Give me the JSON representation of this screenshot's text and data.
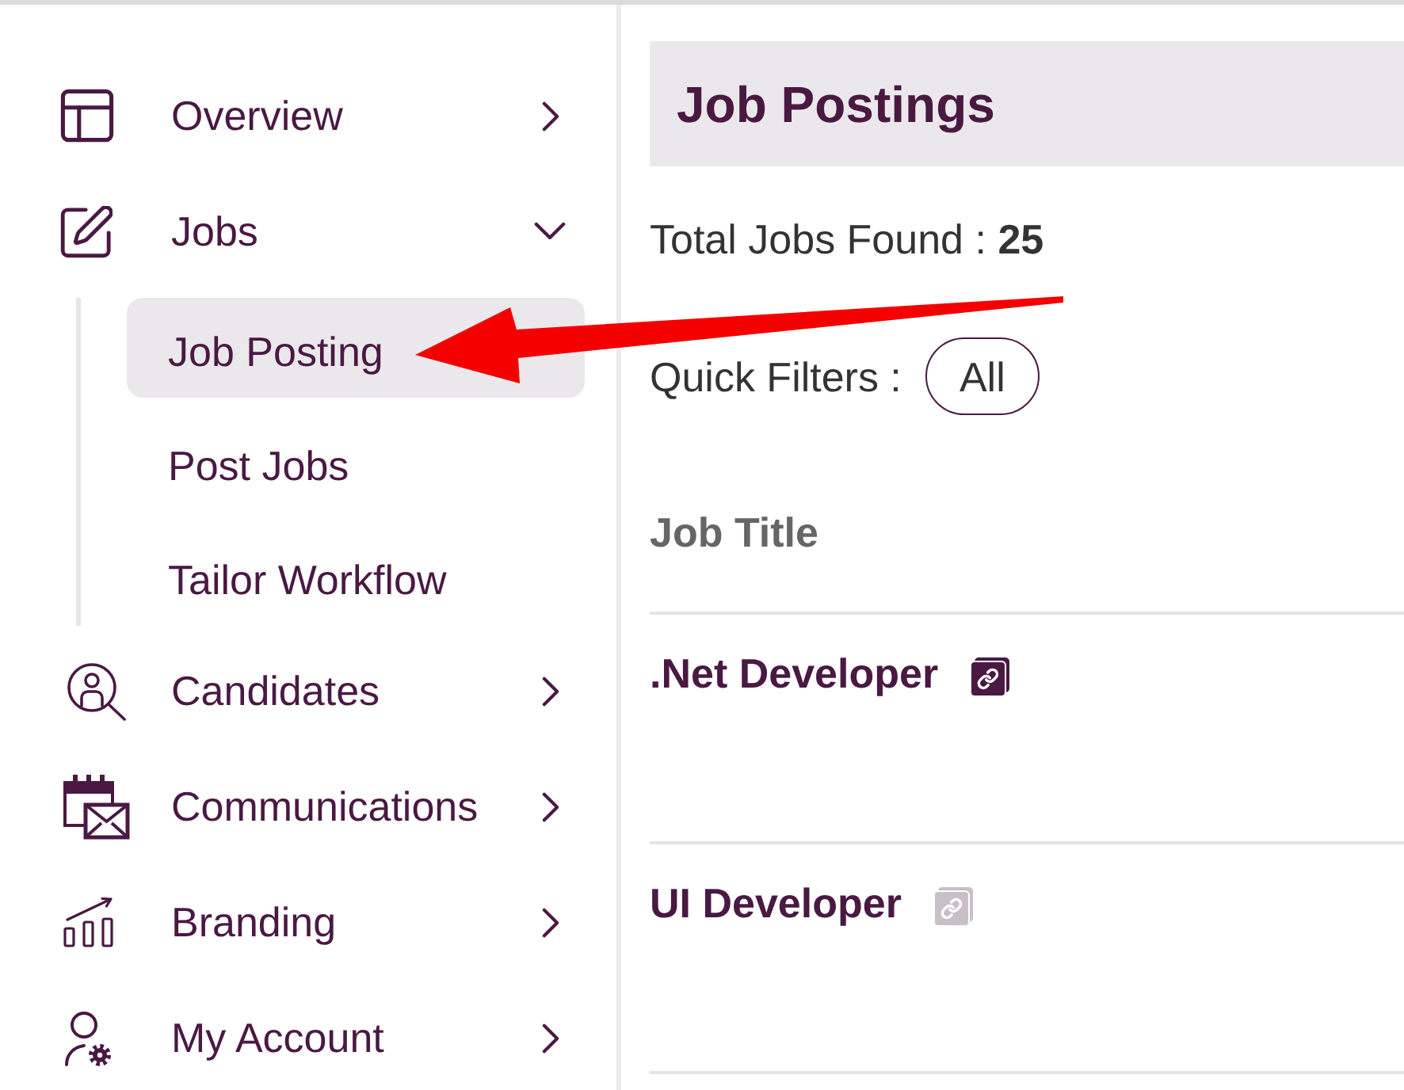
{
  "sidebar": {
    "items": [
      {
        "label": "Overview",
        "expanded": false
      },
      {
        "label": "Jobs",
        "expanded": true,
        "children": [
          {
            "label": "Job Posting",
            "selected": true
          },
          {
            "label": "Post Jobs",
            "selected": false
          },
          {
            "label": "Tailor Workflow",
            "selected": false
          }
        ]
      },
      {
        "label": "Candidates",
        "expanded": false
      },
      {
        "label": "Communications",
        "expanded": false
      },
      {
        "label": "Branding",
        "expanded": false
      },
      {
        "label": "My Account",
        "expanded": false
      }
    ]
  },
  "main": {
    "title": "Job Postings",
    "total_jobs": "Total Jobs Found : **25**",
    "quick_filters": {
      "label": "Quick Filters :",
      "options": [
        {
          "label": "All"
        }
      ]
    }
  },
  "table": {
    "columns": [
      "Job Title"
    ],
    "rows": [
      {
        "title": ".Net Developer",
        "link_enabled": true
      },
      {
        "title": "UI Developer",
        "link_enabled": false
      }
    ]
  }
}
